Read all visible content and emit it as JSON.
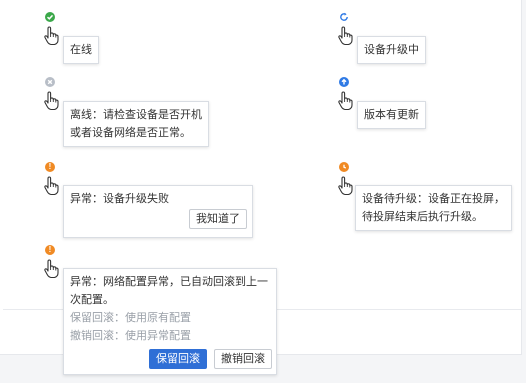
{
  "colors": {
    "online": "#3ba84a",
    "offline": "#b8bec7",
    "warning": "#f08a24",
    "info": "#2f7ae5",
    "primary": "#2f6fd6"
  },
  "items": {
    "online": {
      "icon": "check-circle-icon",
      "text": "在线"
    },
    "upgrading": {
      "icon": "sync-icon",
      "text": "设备升级中"
    },
    "offline": {
      "icon": "x-circle-icon",
      "line1": "离线：请检查设备是否开机",
      "line2": "或者设备网络是否正常。"
    },
    "update": {
      "icon": "arrow-up-circle-icon",
      "text": "版本有更新"
    },
    "upgrade_failed": {
      "icon": "exclamation-circle-icon",
      "text": "异常：设备升级失败",
      "button": "我知道了"
    },
    "pending_upgrade": {
      "icon": "clock-circle-icon",
      "line1": "设备待升级：设备正在投屏，",
      "line2": "待投屏结束后执行升级。"
    },
    "config_error": {
      "icon": "exclamation-circle-icon",
      "line1": "异常：网络配置异常，已自动回滚到上一",
      "line2": "次配置。",
      "keep": "保留回滚：使用原有配置",
      "undo": "撤销回滚：使用异常配置",
      "keep_button": "保留回滚",
      "undo_button": "撤销回滚"
    }
  }
}
